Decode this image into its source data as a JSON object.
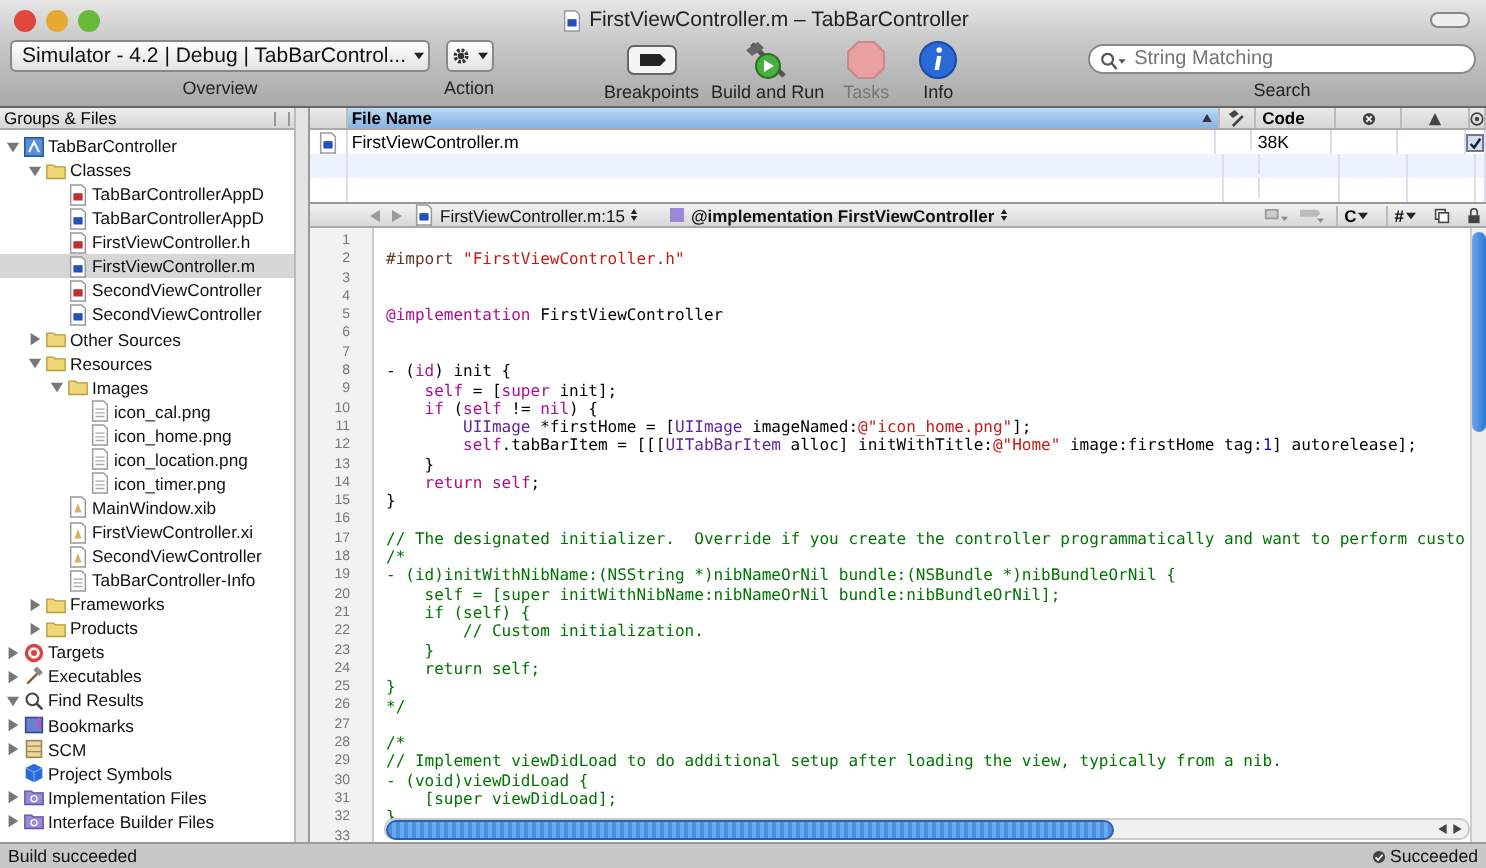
{
  "window": {
    "title": "FirstViewController.m – TabBarController"
  },
  "toolbar": {
    "scheme": "Simulator - 4.2 | Debug | TabBarControl...",
    "scheme_label": "Overview",
    "action_label": "Action",
    "items": [
      {
        "label": "Breakpoints",
        "kind": "breakpoints",
        "disabled": false
      },
      {
        "label": "Build and Run",
        "kind": "build",
        "disabled": false
      },
      {
        "label": "Tasks",
        "kind": "tasks",
        "disabled": true
      },
      {
        "label": "Info",
        "kind": "info",
        "disabled": false
      }
    ],
    "search": {
      "placeholder": "String Matching",
      "label": "Search"
    }
  },
  "sidebar": {
    "header": "Groups & Files",
    "items": [
      {
        "label": "TabBarController",
        "kind": "project",
        "expanded": true,
        "selected": false,
        "children": [
          {
            "label": "Classes",
            "kind": "folder",
            "expanded": true,
            "selected": false,
            "children": [
              {
                "label": "TabBarControllerAppD",
                "kind": "header",
                "selected": false
              },
              {
                "label": "TabBarControllerAppD",
                "kind": "source",
                "selected": false
              },
              {
                "label": "FirstViewController.h",
                "kind": "header",
                "selected": false
              },
              {
                "label": "FirstViewController.m",
                "kind": "source",
                "selected": true
              },
              {
                "label": "SecondViewController",
                "kind": "header",
                "selected": false
              },
              {
                "label": "SecondViewController",
                "kind": "source",
                "selected": false
              }
            ]
          },
          {
            "label": "Other Sources",
            "kind": "folder",
            "expanded": false,
            "selected": false
          },
          {
            "label": "Resources",
            "kind": "folder",
            "expanded": true,
            "selected": false,
            "children": [
              {
                "label": "Images",
                "kind": "folder",
                "expanded": true,
                "selected": false,
                "children": [
                  {
                    "label": "icon_cal.png",
                    "kind": "file",
                    "selected": false
                  },
                  {
                    "label": "icon_home.png",
                    "kind": "file",
                    "selected": false
                  },
                  {
                    "label": "icon_location.png",
                    "kind": "file",
                    "selected": false
                  },
                  {
                    "label": "icon_timer.png",
                    "kind": "file",
                    "selected": false
                  }
                ]
              },
              {
                "label": "MainWindow.xib",
                "kind": "xib",
                "selected": false
              },
              {
                "label": "FirstViewController.xi",
                "kind": "xib",
                "selected": false
              },
              {
                "label": "SecondViewController",
                "kind": "xib",
                "selected": false
              },
              {
                "label": "TabBarController-Info",
                "kind": "file",
                "selected": false
              }
            ]
          },
          {
            "label": "Frameworks",
            "kind": "folder",
            "expanded": false,
            "selected": false
          },
          {
            "label": "Products",
            "kind": "folder",
            "expanded": false,
            "selected": false
          }
        ]
      },
      {
        "label": "Targets",
        "kind": "target",
        "expanded": false,
        "selected": false
      },
      {
        "label": "Executables",
        "kind": "exec",
        "expanded": false,
        "selected": false
      },
      {
        "label": "Find Results",
        "kind": "find",
        "expanded": true,
        "selected": false
      },
      {
        "label": "Bookmarks",
        "kind": "book",
        "expanded": false,
        "selected": false
      },
      {
        "label": "SCM",
        "kind": "scm",
        "expanded": false,
        "selected": false
      },
      {
        "label": "Project Symbols",
        "kind": "symbols",
        "selected": false
      },
      {
        "label": "Implementation Files",
        "kind": "smart",
        "expanded": false,
        "selected": false
      },
      {
        "label": "Interface Builder Files",
        "kind": "smart",
        "expanded": false,
        "selected": false
      }
    ]
  },
  "file_table": {
    "columns": [
      "File Name",
      "Code"
    ],
    "rows": [
      {
        "name": "FirstViewController.m",
        "code": "38K",
        "checked": true
      }
    ]
  },
  "editor": {
    "file_popup": "FirstViewController.m:15",
    "symbol_popup": "@implementation FirstViewController",
    "lang_menu": "C",
    "pound_menu": "#",
    "lines": [
      {
        "num": "1"
      },
      {
        "num": "2",
        "code": [
          {
            "kind": "directive",
            "text": "#import "
          },
          {
            "kind": "string",
            "text": "\"FirstViewController.h\""
          }
        ]
      },
      {
        "num": "3"
      },
      {
        "num": "4"
      },
      {
        "num": "5",
        "code": [
          {
            "kind": "keyword",
            "text": "@implementation"
          },
          {
            "kind": "plain",
            "text": " FirstViewController"
          }
        ]
      },
      {
        "num": "6"
      },
      {
        "num": "7"
      },
      {
        "num": "8",
        "code": [
          {
            "kind": "plain",
            "text": "- ("
          },
          {
            "kind": "keyword",
            "text": "id"
          },
          {
            "kind": "plain",
            "text": ") init {"
          }
        ]
      },
      {
        "num": "9",
        "code": [
          {
            "kind": "keyword",
            "text": "    self"
          },
          {
            "kind": "plain",
            "text": " = ["
          },
          {
            "kind": "keyword",
            "text": "super"
          },
          {
            "kind": "plain",
            "text": " init];"
          }
        ]
      },
      {
        "num": "10",
        "code": [
          {
            "kind": "keyword",
            "text": "    if"
          },
          {
            "kind": "plain",
            "text": " ("
          },
          {
            "kind": "keyword",
            "text": "self"
          },
          {
            "kind": "plain",
            "text": " != "
          },
          {
            "kind": "keyword",
            "text": "nil"
          },
          {
            "kind": "plain",
            "text": ") {"
          }
        ]
      },
      {
        "num": "11",
        "code": [
          {
            "kind": "type",
            "text": "        UIImage"
          },
          {
            "kind": "plain",
            "text": " *firstHome = ["
          },
          {
            "kind": "type",
            "text": "UIImage"
          },
          {
            "kind": "plain",
            "text": " imageNamed:"
          },
          {
            "kind": "string",
            "text": "@\"icon_home.png\""
          },
          {
            "kind": "plain",
            "text": "];"
          }
        ]
      },
      {
        "num": "12",
        "code": [
          {
            "kind": "keyword",
            "text": "        self"
          },
          {
            "kind": "plain",
            "text": ".tabBarItem = [[["
          },
          {
            "kind": "type",
            "text": "UITabBarItem"
          },
          {
            "kind": "plain",
            "text": " alloc] initWithTitle:"
          },
          {
            "kind": "string",
            "text": "@\"Home\""
          },
          {
            "kind": "plain",
            "text": " image:firstHome tag:"
          },
          {
            "kind": "number",
            "text": "1"
          },
          {
            "kind": "plain",
            "text": "] autorelease];"
          }
        ]
      },
      {
        "num": "13",
        "code": [
          {
            "kind": "plain",
            "text": "    }"
          }
        ]
      },
      {
        "num": "14",
        "code": [
          {
            "kind": "keyword",
            "text": "    return"
          },
          {
            "kind": "keyword",
            "text": " self"
          },
          {
            "kind": "plain",
            "text": ";"
          }
        ]
      },
      {
        "num": "15",
        "code": [
          {
            "kind": "plain",
            "text": "}"
          }
        ]
      },
      {
        "num": "16"
      },
      {
        "num": "17",
        "code": [
          {
            "kind": "comment",
            "text": "// The designated initializer.  Override if you create the controller programmatically and want to perform custo"
          }
        ]
      },
      {
        "num": "18",
        "code": [
          {
            "kind": "comment",
            "text": "/*"
          }
        ]
      },
      {
        "num": "19",
        "code": [
          {
            "kind": "comment",
            "text": "- (id)initWithNibName:(NSString *)nibNameOrNil bundle:(NSBundle *)nibBundleOrNil {"
          }
        ]
      },
      {
        "num": "20",
        "code": [
          {
            "kind": "comment",
            "text": "    self = [super initWithNibName:nibNameOrNil bundle:nibBundleOrNil];"
          }
        ]
      },
      {
        "num": "21",
        "code": [
          {
            "kind": "comment",
            "text": "    if (self) {"
          }
        ]
      },
      {
        "num": "22",
        "code": [
          {
            "kind": "comment",
            "text": "        // Custom initialization."
          }
        ]
      },
      {
        "num": "23",
        "code": [
          {
            "kind": "comment",
            "text": "    }"
          }
        ]
      },
      {
        "num": "24",
        "code": [
          {
            "kind": "comment",
            "text": "    return self;"
          }
        ]
      },
      {
        "num": "25",
        "code": [
          {
            "kind": "comment",
            "text": "}"
          }
        ]
      },
      {
        "num": "26",
        "code": [
          {
            "kind": "comment",
            "text": "*/"
          }
        ]
      },
      {
        "num": "27"
      },
      {
        "num": "28",
        "code": [
          {
            "kind": "comment",
            "text": "/*"
          }
        ]
      },
      {
        "num": "29",
        "code": [
          {
            "kind": "comment",
            "text": "// Implement viewDidLoad to do additional setup after loading the view, typically from a nib."
          }
        ]
      },
      {
        "num": "30",
        "code": [
          {
            "kind": "comment",
            "text": "- (void)viewDidLoad {"
          }
        ]
      },
      {
        "num": "31",
        "code": [
          {
            "kind": "comment",
            "text": "    [super viewDidLoad];"
          }
        ]
      },
      {
        "num": "32",
        "code": [
          {
            "kind": "comment",
            "text": "}"
          }
        ]
      },
      {
        "num": "33"
      }
    ]
  },
  "status_bar": {
    "left": "Build succeeded",
    "right": "Succeeded"
  }
}
